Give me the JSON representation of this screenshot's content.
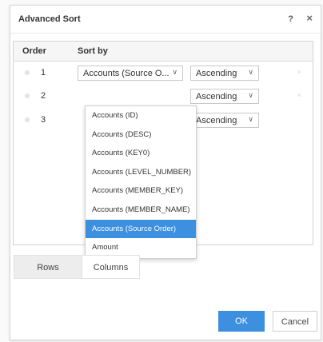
{
  "dialog": {
    "title": "Advanced Sort",
    "help_label": "?",
    "close_label": "×"
  },
  "grid": {
    "headers": {
      "order": "Order",
      "sort_by": "Sort by"
    },
    "rows": [
      {
        "order": "1",
        "sort_by": "Accounts (Source O...",
        "direction": "Ascending",
        "has_delete": true
      },
      {
        "order": "2",
        "sort_by": "",
        "direction": "Ascending",
        "has_delete": true
      },
      {
        "order": "3",
        "sort_by": "",
        "direction": "Ascending",
        "has_delete": false
      }
    ],
    "delete_label": "×",
    "dropdown_arrow": "∨"
  },
  "dropdown": {
    "items": [
      "Accounts (ID)",
      "Accounts (DESC)",
      "Accounts (KEY0)",
      "Accounts (LEVEL_NUMBER)",
      "Accounts (MEMBER_KEY)",
      "Accounts (MEMBER_NAME)",
      "Accounts (Source Order)",
      "Amount"
    ],
    "selected_index": 6
  },
  "tabs": {
    "rows": "Rows",
    "columns": "Columns"
  },
  "footer": {
    "ok": "OK",
    "cancel": "Cancel"
  },
  "colors": {
    "accent": "#3d8fe0"
  },
  "icons": {
    "help": "help-icon",
    "close": "close-icon",
    "chevron": "chevron-down-icon",
    "delete": "delete-row-icon",
    "handle": "drag-handle-icon"
  }
}
